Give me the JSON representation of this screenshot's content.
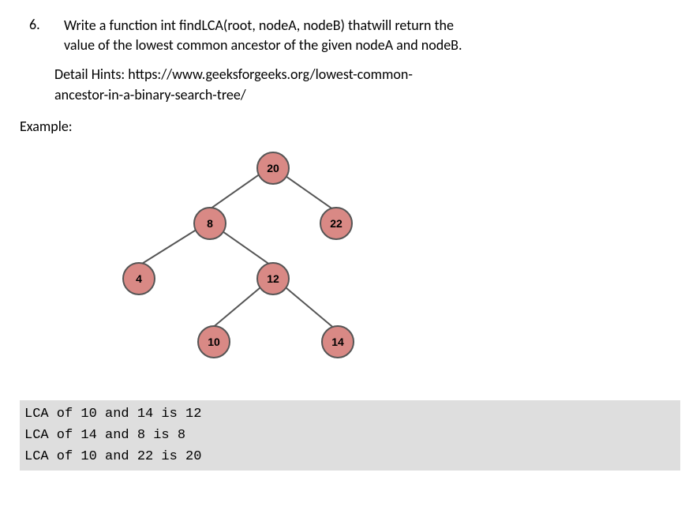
{
  "question": {
    "number": "6.",
    "text_line1": "Write a function int findLCA(root, nodeA, nodeB) thatwill return the",
    "text_line2": "value of the lowest common ancestor of the given nodeA and nodeB.",
    "hints_line1": "Detail Hints: https://www.geeksforgeeks.org/lowest-common-",
    "hints_line2": "ancestor-in-a-binary-search-tree/",
    "example_label": "Example:"
  },
  "tree": {
    "root": "20",
    "left": "8",
    "right": "22",
    "leftleft": "4",
    "leftright": "12",
    "leftrightleft": "10",
    "leftrightright": "14"
  },
  "output": {
    "line1": "LCA of 10 and 14 is 12",
    "line2": "LCA of 14 and 8 is 8",
    "line3": "LCA of 10 and 22 is 20"
  }
}
